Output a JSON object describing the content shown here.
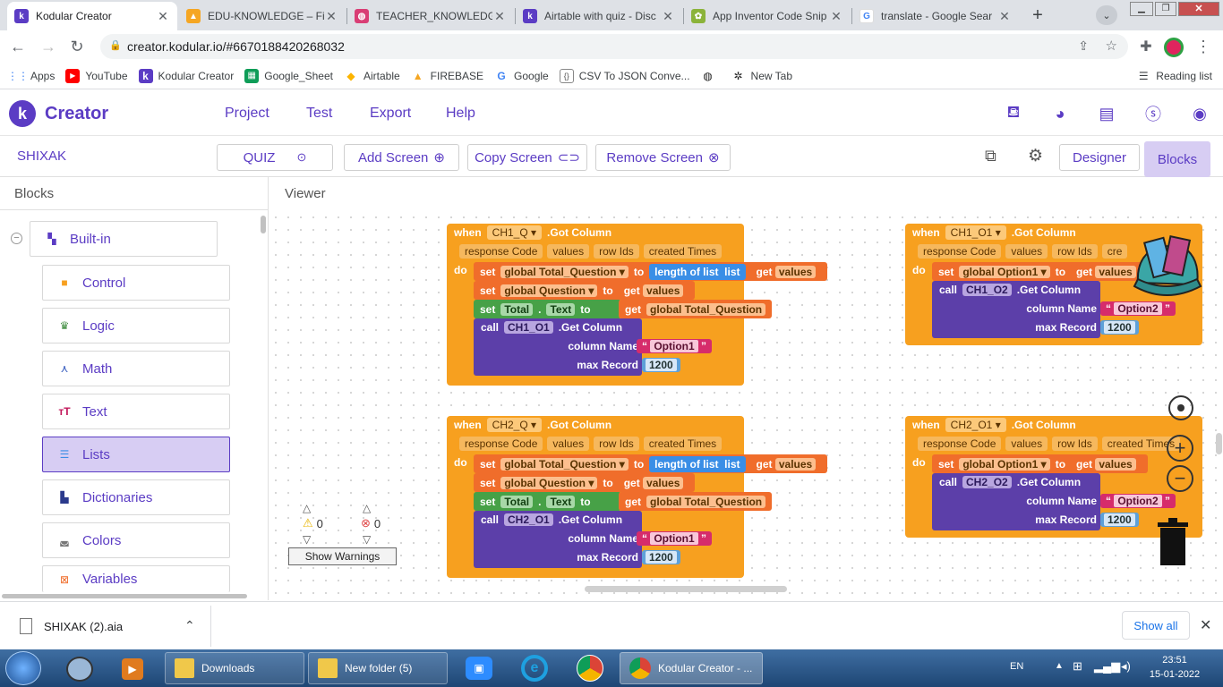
{
  "browser": {
    "tabs": [
      {
        "label": "Kodular Creator",
        "active": true,
        "icon": "kodular-icon",
        "color": "#5b3cc4"
      },
      {
        "label": "EDU-KNOWLEDGE – Fir",
        "icon": "firebase-icon",
        "color": "#f5a623"
      },
      {
        "label": "TEACHER_KNOWLEDGE",
        "icon": "globe-icon",
        "color": "#d93e75"
      },
      {
        "label": "Airtable with quiz - Disc",
        "icon": "kodular-icon",
        "color": "#5b3cc4"
      },
      {
        "label": "App Inventor Code Snip",
        "icon": "appinventor-icon",
        "color": "#8bb33a"
      },
      {
        "label": "translate - Google Sear",
        "icon": "google-icon",
        "color": "#4285f4"
      }
    ],
    "new_tab_symbol": "+",
    "url": "creator.kodular.io/#6670188420268032",
    "bookmarks": [
      {
        "label": "Apps",
        "icon": "apps-grid-icon"
      },
      {
        "label": "YouTube",
        "icon": "youtube-icon"
      },
      {
        "label": "Kodular Creator",
        "icon": "kodular-icon"
      },
      {
        "label": "Google_Sheet",
        "icon": "sheets-icon"
      },
      {
        "label": "Airtable",
        "icon": "airtable-icon"
      },
      {
        "label": "FIREBASE",
        "icon": "firebase-icon"
      },
      {
        "label": "Google",
        "icon": "google-icon"
      },
      {
        "label": "CSV To JSON Conve...",
        "icon": "csv-icon"
      },
      {
        "label": "",
        "icon": "globe-icon"
      },
      {
        "label": "New Tab",
        "icon": "bug-icon"
      }
    ],
    "reading_list": "Reading list"
  },
  "app": {
    "brand": "Creator",
    "menu": [
      "Project",
      "Test",
      "Export",
      "Help"
    ],
    "project_name": "SHIXAK",
    "screen_select": "QUIZ",
    "add_screen": "Add Screen",
    "copy_screen": "Copy Screen",
    "remove_screen": "Remove Screen",
    "designer": "Designer",
    "blocks": "Blocks"
  },
  "left": {
    "title": "Blocks",
    "builtin": "Built-in",
    "categories": [
      {
        "label": "Control",
        "color": "#f7a01f",
        "icon": "control-icon"
      },
      {
        "label": "Logic",
        "color": "#3d8b3d",
        "icon": "logic-icon"
      },
      {
        "label": "Math",
        "color": "#3a5fc0",
        "icon": "math-icon"
      },
      {
        "label": "Text",
        "color": "#c2185b",
        "icon": "text-icon"
      },
      {
        "label": "Lists",
        "color": "#3a8ee6",
        "icon": "lists-icon",
        "selected": true
      },
      {
        "label": "Dictionaries",
        "color": "#2b3a8c",
        "icon": "dictionaries-icon"
      },
      {
        "label": "Colors",
        "color": "#777777",
        "icon": "colors-icon"
      },
      {
        "label": "Variables",
        "color": "#f06d2b",
        "icon": "variables-icon"
      }
    ]
  },
  "viewer": {
    "title": "Viewer",
    "warnings_count": "0",
    "errors_count": "0",
    "show_warnings": "Show Warnings",
    "events": [
      {
        "when": "when",
        "component": "CH1_Q",
        "event": ".Got Column",
        "params": [
          "response Code",
          "values",
          "row Ids",
          "created Times"
        ],
        "do": "do",
        "set1_var": "global Total_Question",
        "to": "to",
        "length": "length of list",
        "list": "list",
        "get": "get",
        "get_var1": "values",
        "set2_var": "global Question",
        "get_var2": "values",
        "set3_comp": "Total",
        "set3_prop": "Text",
        "get_var3": "global Total_Question",
        "set": "set",
        "call": "call",
        "call_comp": "CH1_O1",
        "call_method": ".Get Column",
        "column_label": "column Name",
        "column_value": "Option1",
        "max_label": "max Record",
        "max_value": "1200"
      },
      {
        "when": "when",
        "component": "CH2_Q",
        "event": ".Got Column",
        "params": [
          "response Code",
          "values",
          "row Ids",
          "created Times"
        ],
        "do": "do",
        "set1_var": "global Total_Question",
        "to": "to",
        "length": "length of list",
        "list": "list",
        "get": "get",
        "get_var1": "values",
        "set2_var": "global Question",
        "get_var2": "values",
        "set3_comp": "Total",
        "set3_prop": "Text",
        "get_var3": "global Total_Question",
        "set": "set",
        "call": "call",
        "call_comp": "CH2_O1",
        "call_method": ".Get Column",
        "column_label": "column Name",
        "column_value": "Option1",
        "max_label": "max Record",
        "max_value": "1200"
      },
      {
        "when": "when",
        "component": "CH1_O1",
        "event": ".Got Column",
        "params": [
          "response Code",
          "values",
          "row Ids",
          "cre"
        ],
        "do": "do",
        "set1_var": "global Option1",
        "to": "to",
        "get": "get",
        "get_var1": "values",
        "set": "set",
        "call": "call",
        "call_comp": "CH1_O2",
        "call_method": ".Get Column",
        "column_label": "column Name",
        "column_value": "Option2",
        "max_label": "max Record",
        "max_value": "1200"
      },
      {
        "when": "when",
        "component": "CH2_O1",
        "event": ".Got Column",
        "params": [
          "response Code",
          "values",
          "row Ids",
          "created Times"
        ],
        "do": "do",
        "set1_var": "global Option1",
        "to": "to",
        "get": "get",
        "get_var1": "values",
        "set": "set",
        "call": "call",
        "call_comp": "CH2_O2",
        "call_method": ".Get Column",
        "column_label": "column Name",
        "column_value": "Option2",
        "max_label": "max Record",
        "max_value": "1200"
      }
    ]
  },
  "downloads": {
    "file": "SHIXAK (2).aia",
    "show_all": "Show all"
  },
  "taskbar": {
    "items": [
      {
        "label": "Downloads"
      },
      {
        "label": "New folder (5)"
      },
      {
        "label": "Kodular Creator - ..."
      }
    ],
    "lang": "EN",
    "time": "23:51",
    "date": "15-01-2022"
  }
}
